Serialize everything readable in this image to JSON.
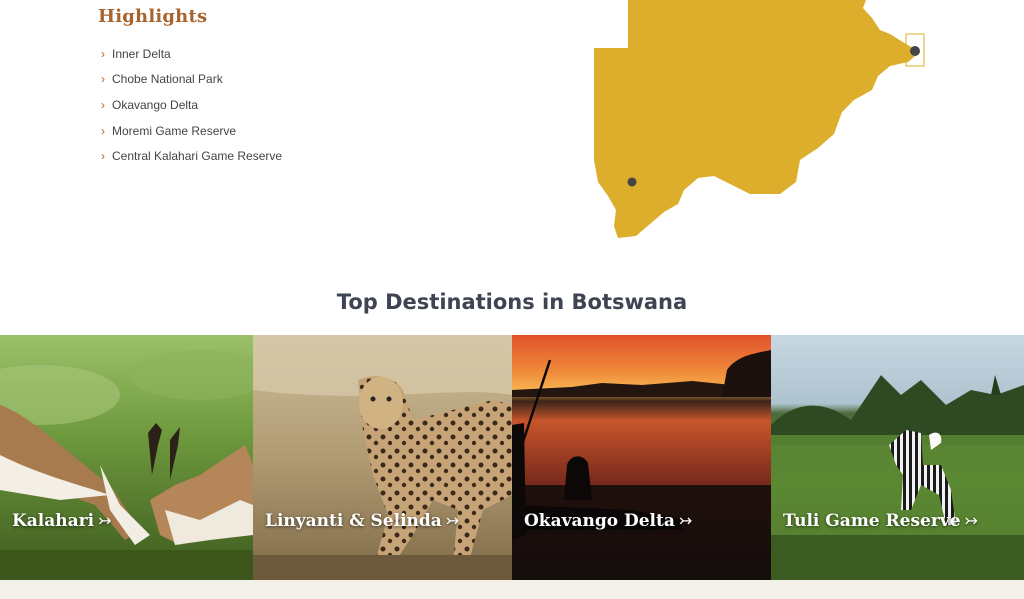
{
  "highlights": {
    "title": "Highlights",
    "chevron": "›",
    "items": [
      {
        "label": "Inner Delta"
      },
      {
        "label": "Chobe National Park"
      },
      {
        "label": "Okavango Delta"
      },
      {
        "label": "Moremi Game Reserve"
      },
      {
        "label": "Central Kalahari Game Reserve"
      }
    ]
  },
  "map": {
    "country_icon": "botswana-map-icon",
    "fill_color": "#dcae2b",
    "marker_color": "#454545"
  },
  "destinations": {
    "title": "Top Destinations in Botswana",
    "arrow": "↣",
    "tiles": [
      {
        "label": "Kalahari",
        "icon": "springbok-photo"
      },
      {
        "label": "Linyanti & Selinda",
        "icon": "leopard-photo"
      },
      {
        "label": "Okavango Delta",
        "icon": "sunset-mokoro-photo"
      },
      {
        "label": "Tuli Game Reserve",
        "icon": "zebra-photo"
      }
    ]
  },
  "colors": {
    "accent": "#a7642d",
    "heading": "#3f4453",
    "footer_strip": "#f3efe9"
  }
}
